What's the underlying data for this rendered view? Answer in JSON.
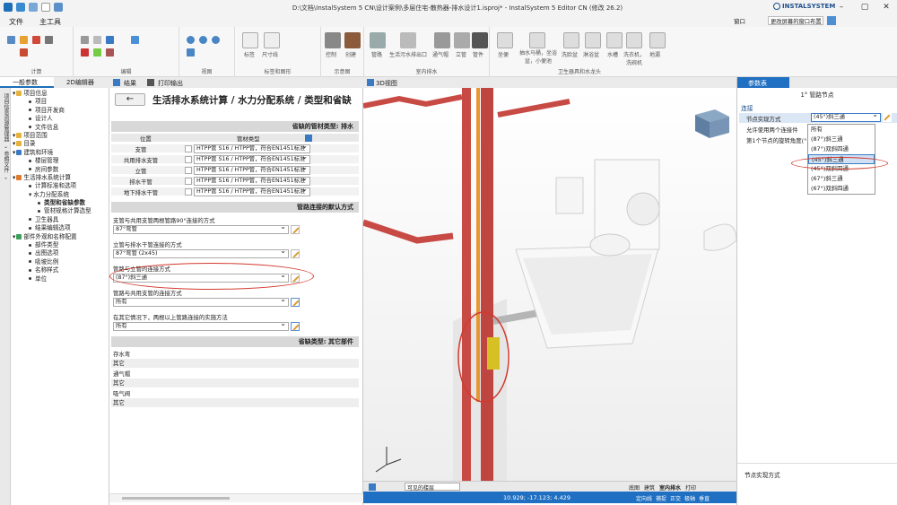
{
  "titlebar": {
    "title": "D:\\文档\\InstalSystem 5 CN\\设计案例\\多层住宅-散热器-排水设计1.isproj* - InstalSystem 5 Editor CN (修改 26.2)",
    "brand": "INSTALSYSTEM"
  },
  "menu": {
    "file": "文件",
    "tools": "主工具"
  },
  "ribbon": {
    "groups": [
      "计算",
      "编辑",
      "视图",
      "标签和图形",
      "示意图",
      "室内排水",
      "卫生器具和水龙头"
    ],
    "labels": {
      "annot": "标签",
      "dim": "尺寸线",
      "control": "控制",
      "create": "创建",
      "pipe": "管路",
      "drain_outlet": "生活污水排出口",
      "vent": "通气帽",
      "riser": "立管",
      "fitting": "管件",
      "wc": "坐便",
      "bidet": "抽水马桶，坐浴盆，小便池",
      "washbasin": "洗脸盆",
      "shower": "淋浴盆",
      "sink": "水槽",
      "washer": "洗衣机，洗碗机",
      "floor_drain": "地漏"
    }
  },
  "right_top": {
    "window": "窗口",
    "layout": "更改屏幕的窗口布置"
  },
  "left": {
    "tab1": "一般参数",
    "tab2": "2D编辑器",
    "strip": "项目信息资源管理器 ⌄  参照文件 ⌄",
    "tree": [
      {
        "t": "项目信息",
        "lvl": 0,
        "k": "folder"
      },
      {
        "t": "项目",
        "lvl": 1,
        "k": "dot"
      },
      {
        "t": "项目开发商",
        "lvl": 1,
        "k": "dot"
      },
      {
        "t": "设计人",
        "lvl": 1,
        "k": "dot"
      },
      {
        "t": "文件信息",
        "lvl": 1,
        "k": "dot"
      },
      {
        "t": "项目范围",
        "lvl": 0,
        "k": "folder"
      },
      {
        "t": "目录",
        "lvl": 0,
        "k": "folder"
      },
      {
        "t": "建筑和环境",
        "lvl": 0,
        "k": "blue"
      },
      {
        "t": "楼层管理",
        "lvl": 1,
        "k": "dot"
      },
      {
        "t": "房间参数",
        "lvl": 1,
        "k": "dot"
      },
      {
        "t": "生活排水系统计算",
        "lvl": 0,
        "k": "orange"
      },
      {
        "t": "计算标准和选项",
        "lvl": 1,
        "k": "dot"
      },
      {
        "t": "水力分配系统",
        "lvl": 1,
        "k": "none"
      },
      {
        "t": "类型和省缺参数",
        "lvl": 2,
        "k": "dot",
        "sel": true
      },
      {
        "t": "管材规格计算选型",
        "lvl": 2,
        "k": "dot"
      },
      {
        "t": "卫生器具",
        "lvl": 1,
        "k": "dot"
      },
      {
        "t": "结果编辑选项",
        "lvl": 1,
        "k": "dot"
      },
      {
        "t": "部件外观和名称配置",
        "lvl": 0,
        "k": "green"
      },
      {
        "t": "部件类型",
        "lvl": 1,
        "k": "dot"
      },
      {
        "t": "出图选项",
        "lvl": 1,
        "k": "dot"
      },
      {
        "t": "吸坡比例",
        "lvl": 1,
        "k": "dot"
      },
      {
        "t": "名称样式",
        "lvl": 1,
        "k": "dot"
      },
      {
        "t": "单位",
        "lvl": 1,
        "k": "dot"
      }
    ]
  },
  "form": {
    "tab_result": "结果",
    "tab_print": "打印输出",
    "heading": "生活排水系统计算 / 水力分配系统 / 类型和省缺",
    "sec1": "省缺的管材类型: 排水",
    "col_pos": "位置",
    "col_type": "管材类型",
    "rows": [
      {
        "pos": "支管",
        "val": "HTPP管 S16 / HTPP管，符合EN1451标准"
      },
      {
        "pos": "共用排水支管",
        "val": "HTPP管 S16 / HTPP管，符合EN1451标准"
      },
      {
        "pos": "立管",
        "val": "HTPP管 S16 / HTPP管，符合EN1451标准"
      },
      {
        "pos": "排水干管",
        "val": "HTPP管 S16 / HTPP管，符合EN1451标准"
      },
      {
        "pos": "地下排水干管",
        "val": "HTPP管 S16 / HTPP管，符合EN1451标准"
      }
    ],
    "sec2": "管路连接的默认方式",
    "q1": "支管与共用支管两根管路90°连接的方式",
    "a1": "87°弯管",
    "q2": "立管与排水干管连接的方式",
    "a2": "87°弯管 (2x45)",
    "q3": "管路与立管的连接方式",
    "a3": "(87°)斜三通",
    "q4": "管路与共用支管的连接方式",
    "a4": "所有",
    "q5": "在其它情况下，两根以上管路连接的实施方法",
    "a5": "所有",
    "sec3": "省缺类型: 其它部件",
    "others": [
      {
        "label": "存水弯",
        "val": "其它"
      },
      {
        "label": "通气帽",
        "val": "其它"
      },
      {
        "label": "吸气阀",
        "val": "其它"
      }
    ]
  },
  "view": {
    "tab": "3D视图",
    "layer": "可见的楼层",
    "coords": "10.929; -17.123; 4.429",
    "status": [
      "定向线",
      "捕捉",
      "正交",
      "极轴",
      "垂直"
    ],
    "bottom_tabs": [
      "底图",
      "建筑",
      "室内排水",
      "打印"
    ]
  },
  "rightp": {
    "tab": "参数表",
    "title": "1° 管路节点",
    "group": "连接",
    "prop1": "节点实现方式",
    "prop1_val": "(45°)斜三通",
    "prop2": "允许使用两个连接件",
    "prop3": "第1个节点的旋转角度(°",
    "options": [
      "所有",
      "(87°)斜三通",
      "(87°)双斜四通",
      "(45°)斜三通",
      "(45°)双斜四通",
      "(67°)斜三通",
      "(67°)双斜四通"
    ],
    "footer": "节点实现方式"
  }
}
